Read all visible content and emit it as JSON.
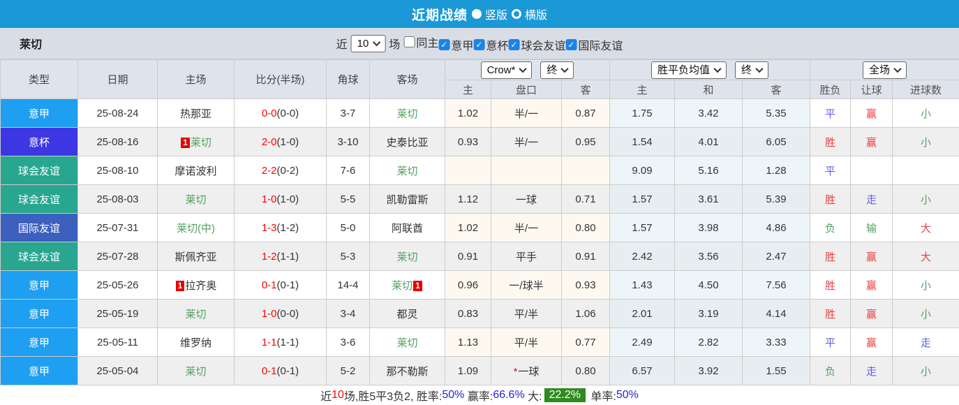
{
  "titlebar": {
    "title": "近期战绩",
    "vertical_label": "竖版",
    "horizontal_label": "横版",
    "selected_option": "竖版"
  },
  "filterbar": {
    "team": "莱切",
    "near_label": "近",
    "count_value": "10",
    "games_label": "场",
    "items": [
      {
        "label": "同主",
        "checked": false
      },
      {
        "label": "意甲",
        "checked": true
      },
      {
        "label": "意杯",
        "checked": true
      },
      {
        "label": "球会友谊",
        "checked": true
      },
      {
        "label": "国际友谊",
        "checked": true
      }
    ]
  },
  "table": {
    "headers": [
      "类型",
      "日期",
      "主场",
      "比分(半场)",
      "角球",
      "客场"
    ],
    "selects": {
      "bookmaker": "Crow*",
      "asia_time": "终",
      "europe_metric": "胜平负均值",
      "europe_time": "终",
      "scope": "全场"
    },
    "sub_headers": [
      "主",
      "盘口",
      "客",
      "主",
      "和",
      "客",
      "胜负",
      "让球",
      "进球数"
    ],
    "rows": [
      {
        "league": "意甲",
        "league_color": "#1e9ff2",
        "date": "25-08-24",
        "home": {
          "name": "热那亚",
          "lecce": false,
          "card_before": false,
          "card_after": false
        },
        "score_full": "0-0",
        "score_half": "(0-0)",
        "corners": "3-7",
        "away": {
          "name": "莱切",
          "lecce": true,
          "card_before": false,
          "card_after": false
        },
        "asia_home": "1.02",
        "handicap": "半/一",
        "handicap_star": false,
        "asia_away": "0.87",
        "euro_home": "1.75",
        "euro_draw": "3.42",
        "euro_away": "5.35",
        "result": {
          "text": "平",
          "color": "blue"
        },
        "handicap_result": {
          "text": "赢",
          "color": "red"
        },
        "goals": {
          "text": "小",
          "color": "green"
        }
      },
      {
        "league": "意杯",
        "league_color": "#3c37e2",
        "date": "25-08-16",
        "home": {
          "name": "莱切",
          "lecce": true,
          "card_before": true,
          "card_after": false
        },
        "score_full": "2-0",
        "score_half": "(1-0)",
        "corners": "3-10",
        "away": {
          "name": "史泰比亚",
          "lecce": false,
          "card_before": false,
          "card_after": false
        },
        "asia_home": "0.93",
        "handicap": "半/一",
        "handicap_star": false,
        "asia_away": "0.95",
        "euro_home": "1.54",
        "euro_draw": "4.01",
        "euro_away": "6.05",
        "result": {
          "text": "胜",
          "color": "red"
        },
        "handicap_result": {
          "text": "赢",
          "color": "red"
        },
        "goals": {
          "text": "小",
          "color": "green"
        }
      },
      {
        "league": "球会友谊",
        "league_color": "#28a690",
        "date": "25-08-10",
        "home": {
          "name": "摩诺波利",
          "lecce": false,
          "card_before": false,
          "card_after": false
        },
        "score_full": "2-2",
        "score_half": "(0-2)",
        "corners": "7-6",
        "away": {
          "name": "莱切",
          "lecce": true,
          "card_before": false,
          "card_after": false
        },
        "asia_home": "",
        "handicap": "",
        "handicap_star": false,
        "asia_away": "",
        "euro_home": "9.09",
        "euro_draw": "5.16",
        "euro_away": "1.28",
        "result": {
          "text": "平",
          "color": "blue"
        },
        "handicap_result": {
          "text": "",
          "color": ""
        },
        "goals": {
          "text": "",
          "color": ""
        }
      },
      {
        "league": "球会友谊",
        "league_color": "#28a690",
        "date": "25-08-03",
        "home": {
          "name": "莱切",
          "lecce": true,
          "card_before": false,
          "card_after": false
        },
        "score_full": "1-0",
        "score_half": "(1-0)",
        "corners": "5-5",
        "away": {
          "name": "凯勒雷斯",
          "lecce": false,
          "card_before": false,
          "card_after": false
        },
        "asia_home": "1.12",
        "handicap": "一球",
        "handicap_star": false,
        "asia_away": "0.71",
        "euro_home": "1.57",
        "euro_draw": "3.61",
        "euro_away": "5.39",
        "result": {
          "text": "胜",
          "color": "red"
        },
        "handicap_result": {
          "text": "走",
          "color": "blue"
        },
        "goals": {
          "text": "小",
          "color": "green"
        }
      },
      {
        "league": "国际友谊",
        "league_color": "#3d60bf",
        "date": "25-07-31",
        "home": {
          "name": "莱切(中)",
          "lecce": true,
          "card_before": false,
          "card_after": false
        },
        "score_full": "1-3",
        "score_half": "(1-2)",
        "corners": "5-0",
        "away": {
          "name": "阿联酋",
          "lecce": false,
          "card_before": false,
          "card_after": false
        },
        "asia_home": "1.02",
        "handicap": "半/一",
        "handicap_star": false,
        "asia_away": "0.80",
        "euro_home": "1.57",
        "euro_draw": "3.98",
        "euro_away": "4.86",
        "result": {
          "text": "负",
          "color": "green"
        },
        "handicap_result": {
          "text": "输",
          "color": "green"
        },
        "goals": {
          "text": "大",
          "color": "red"
        }
      },
      {
        "league": "球会友谊",
        "league_color": "#28a690",
        "date": "25-07-28",
        "home": {
          "name": "斯佩齐亚",
          "lecce": false,
          "card_before": false,
          "card_after": false
        },
        "score_full": "1-2",
        "score_half": "(1-1)",
        "corners": "5-3",
        "away": {
          "name": "莱切",
          "lecce": true,
          "card_before": false,
          "card_after": false
        },
        "asia_home": "0.91",
        "handicap": "平手",
        "handicap_star": false,
        "asia_away": "0.91",
        "euro_home": "2.42",
        "euro_draw": "3.56",
        "euro_away": "2.47",
        "result": {
          "text": "胜",
          "color": "red"
        },
        "handicap_result": {
          "text": "赢",
          "color": "red"
        },
        "goals": {
          "text": "大",
          "color": "red"
        }
      },
      {
        "league": "意甲",
        "league_color": "#1e9ff2",
        "date": "25-05-26",
        "home": {
          "name": "拉齐奥",
          "lecce": false,
          "card_before": true,
          "card_after": false
        },
        "score_full": "0-1",
        "score_half": "(0-1)",
        "corners": "14-4",
        "away": {
          "name": "莱切",
          "lecce": true,
          "card_before": false,
          "card_after": true
        },
        "asia_home": "0.96",
        "handicap": "一/球半",
        "handicap_star": false,
        "asia_away": "0.93",
        "euro_home": "1.43",
        "euro_draw": "4.50",
        "euro_away": "7.56",
        "result": {
          "text": "胜",
          "color": "red"
        },
        "handicap_result": {
          "text": "赢",
          "color": "red"
        },
        "goals": {
          "text": "小",
          "color": "green"
        }
      },
      {
        "league": "意甲",
        "league_color": "#1e9ff2",
        "date": "25-05-19",
        "home": {
          "name": "莱切",
          "lecce": true,
          "card_before": false,
          "card_after": false
        },
        "score_full": "1-0",
        "score_half": "(0-0)",
        "corners": "3-4",
        "away": {
          "name": "都灵",
          "lecce": false,
          "card_before": false,
          "card_after": false
        },
        "asia_home": "0.83",
        "handicap": "平/半",
        "handicap_star": false,
        "asia_away": "1.06",
        "euro_home": "2.01",
        "euro_draw": "3.19",
        "euro_away": "4.14",
        "result": {
          "text": "胜",
          "color": "red"
        },
        "handicap_result": {
          "text": "赢",
          "color": "red"
        },
        "goals": {
          "text": "小",
          "color": "green"
        }
      },
      {
        "league": "意甲",
        "league_color": "#1e9ff2",
        "date": "25-05-11",
        "home": {
          "name": "维罗纳",
          "lecce": false,
          "card_before": false,
          "card_after": false
        },
        "score_full": "1-1",
        "score_half": "(1-1)",
        "corners": "3-6",
        "away": {
          "name": "莱切",
          "lecce": true,
          "card_before": false,
          "card_after": false
        },
        "asia_home": "1.13",
        "handicap": "平/半",
        "handicap_star": false,
        "asia_away": "0.77",
        "euro_home": "2.49",
        "euro_draw": "2.82",
        "euro_away": "3.33",
        "result": {
          "text": "平",
          "color": "blue"
        },
        "handicap_result": {
          "text": "赢",
          "color": "red"
        },
        "goals": {
          "text": "走",
          "color": "blue"
        }
      },
      {
        "league": "意甲",
        "league_color": "#1e9ff2",
        "date": "25-05-04",
        "home": {
          "name": "莱切",
          "lecce": true,
          "card_before": false,
          "card_after": false
        },
        "score_full": "0-1",
        "score_half": "(0-1)",
        "corners": "5-2",
        "away": {
          "name": "那不勒斯",
          "lecce": false,
          "card_before": false,
          "card_after": false
        },
        "asia_home": "1.09",
        "handicap": "一球",
        "handicap_star": true,
        "asia_away": "0.80",
        "euro_home": "6.57",
        "euro_draw": "3.92",
        "euro_away": "1.55",
        "result": {
          "text": "负",
          "color": "green"
        },
        "handicap_result": {
          "text": "走",
          "color": "blue"
        },
        "goals": {
          "text": "小",
          "color": "green"
        }
      }
    ]
  },
  "summary": {
    "segments": [
      {
        "text": "近",
        "style": "black"
      },
      {
        "text": "10",
        "style": "red"
      },
      {
        "text": "场,胜5平3负2, 胜率:",
        "style": "black"
      },
      {
        "text": "50%",
        "style": "blue"
      },
      {
        "text": " 赢率:",
        "style": "black"
      },
      {
        "text": "66.6%",
        "style": "blue"
      },
      {
        "text": " 大:",
        "style": "black"
      },
      {
        "text": "22.2%",
        "style": "greenbg"
      },
      {
        "text": " 单率:",
        "style": "black"
      },
      {
        "text": "50%",
        "style": "blue"
      }
    ]
  },
  "colors": {
    "topbar": "#1a99d6",
    "league_serie_a": "#1e9ff2",
    "league_coppa_italia": "#3c37e2",
    "league_club_friendly": "#28a690",
    "league_intl_friendly": "#3d60bf",
    "score_red": "#ff0000",
    "win_red": "#e84040",
    "draw_blue": "#5e5ef0",
    "lose_green": "#55a061",
    "summary_highlight_bg": "#2e8b1e"
  }
}
